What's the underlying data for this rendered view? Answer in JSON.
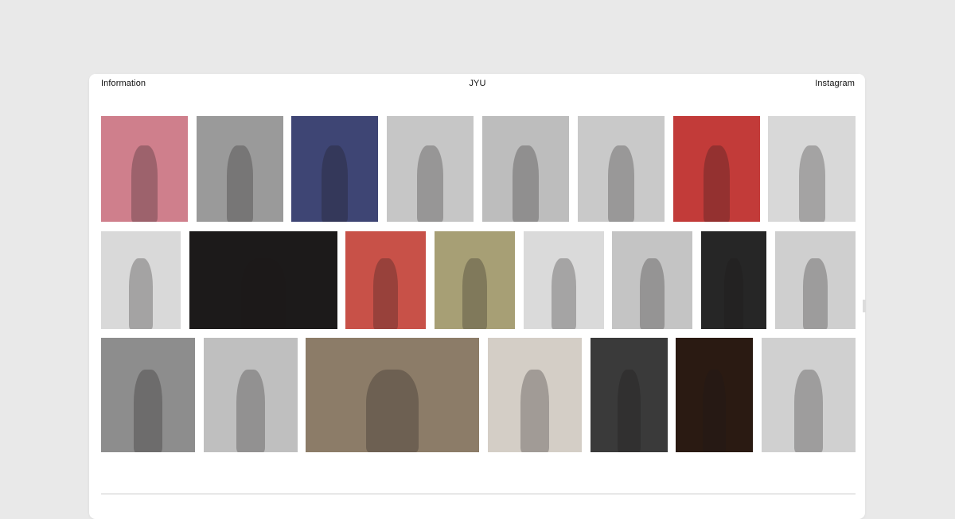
{
  "header": {
    "left_link": "Information",
    "title": "JYU",
    "right_link": "Instagram"
  },
  "gallery": {
    "rows": [
      [
        {
          "name": "photo-pink-backdrop-studio",
          "bg": "#cf7f8c"
        },
        {
          "name": "photo-profile-man-bw",
          "bg": "#9a9a9a"
        },
        {
          "name": "photo-model-blue-backdrop",
          "bg": "#3e4574"
        },
        {
          "name": "photo-standing-figure-bw",
          "bg": "#c6c6c6"
        },
        {
          "name": "photo-woman-jacket-bw",
          "bg": "#bdbdbd"
        },
        {
          "name": "photo-smiling-woman-bw",
          "bg": "#c9c9c9"
        },
        {
          "name": "photo-blonde-red-backdrop",
          "bg": "#c23b39"
        },
        {
          "name": "photo-curly-hair-purple-sweater",
          "bg": "#d8d8d8"
        }
      ],
      [
        {
          "name": "photo-two-models",
          "bg": "#d9d9d9"
        },
        {
          "name": "photo-mannequins-red-room",
          "bg": "#1c1a1a"
        },
        {
          "name": "photo-seated-red-backdrop",
          "bg": "#c85148"
        },
        {
          "name": "photo-olive-wall-figure",
          "bg": "#a79f75"
        },
        {
          "name": "photo-seated-stool-bw",
          "bg": "#dadada"
        },
        {
          "name": "photo-tank-top-man-bw",
          "bg": "#c4c4c4"
        },
        {
          "name": "photo-night-doorway",
          "bg": "#262626"
        },
        {
          "name": "photo-pose-hand-head-bw",
          "bg": "#cfcfcf"
        }
      ],
      [
        {
          "name": "photo-kneeling-model-bw",
          "bg": "#8d8d8d"
        },
        {
          "name": "photo-seated-afro-bw",
          "bg": "#bfbfbf"
        },
        {
          "name": "photo-street-runway",
          "bg": "#8c7c68"
        },
        {
          "name": "photo-flowers-cap",
          "bg": "#d4cec6"
        },
        {
          "name": "photo-runway-dark-hall",
          "bg": "#3a3a3a"
        },
        {
          "name": "photo-night-storefront",
          "bg": "#2a1a12"
        },
        {
          "name": "photo-flared-pants-bw",
          "bg": "#d0d0d0"
        }
      ]
    ]
  }
}
